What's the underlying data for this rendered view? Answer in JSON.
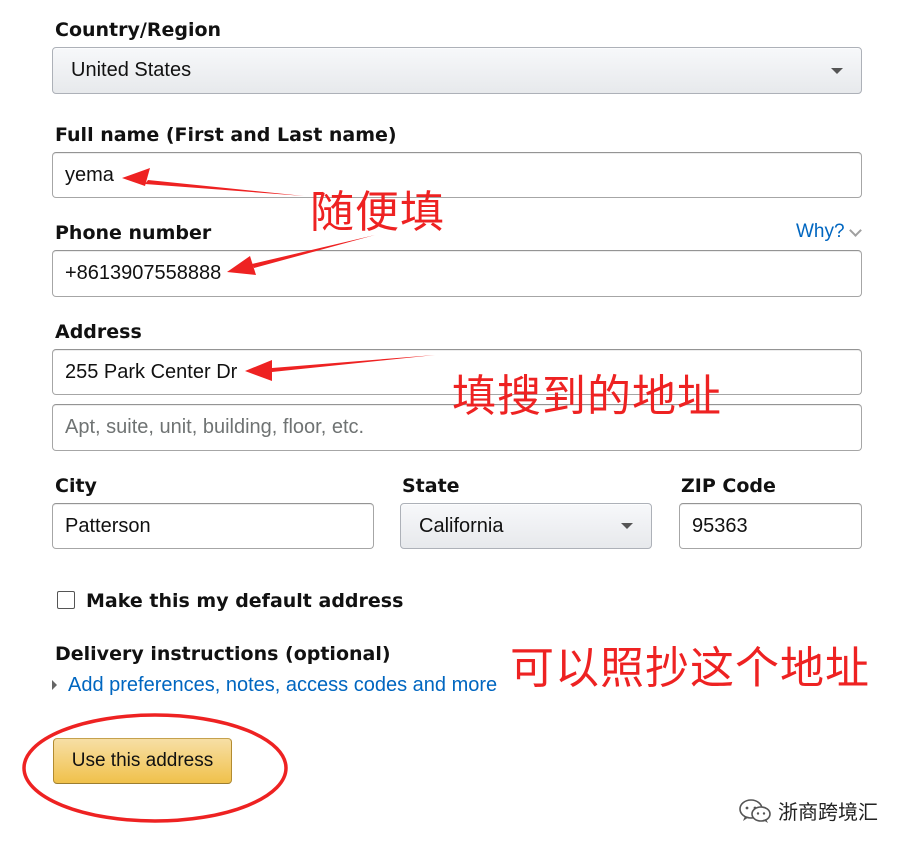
{
  "form": {
    "country": {
      "label": "Country/Region",
      "value": "United States"
    },
    "full_name": {
      "label": "Full name (First and Last name)",
      "value": "yema"
    },
    "phone": {
      "label": "Phone number",
      "value": "+8613907558888",
      "help_link": "Why?"
    },
    "address": {
      "label": "Address",
      "line1_value": "255 Park Center Dr",
      "line2_placeholder": "Apt, suite, unit, building, floor, etc."
    },
    "city": {
      "label": "City",
      "value": "Patterson"
    },
    "state": {
      "label": "State",
      "value": "California"
    },
    "zip": {
      "label": "ZIP Code",
      "value": "95363"
    },
    "default_address_checkbox": {
      "label": "Make this my default address",
      "checked": false
    },
    "delivery": {
      "label": "Delivery instructions (optional)",
      "link": "Add preferences, notes, access codes and more"
    },
    "submit_label": "Use this address"
  },
  "annotations": {
    "name_note": "随便填",
    "address_note": "填搜到的地址",
    "copy_note": "可以照抄这个地址",
    "annotation_color": "#ee2222"
  },
  "watermark": {
    "text": "浙商跨境汇",
    "icon": "wechat-icon"
  },
  "colors": {
    "link": "#0066c0",
    "button_gradient_top": "#f7dfa5",
    "button_gradient_bottom": "#f0c14b"
  }
}
